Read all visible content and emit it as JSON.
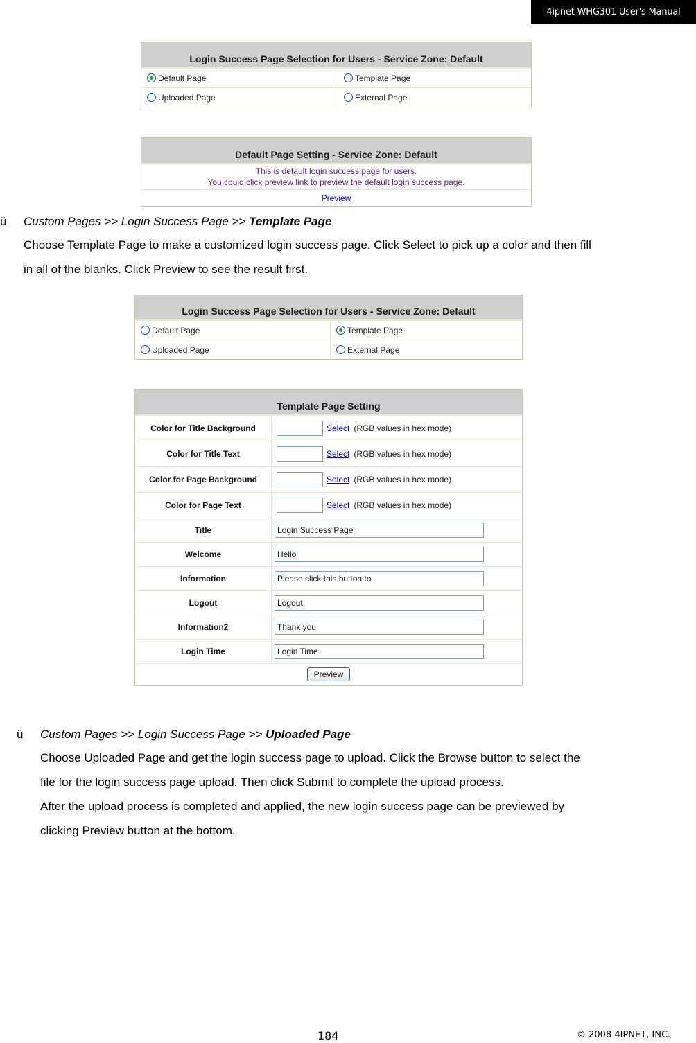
{
  "header": {
    "manual_title": "4ipnet WHG301 User's Manual"
  },
  "selection_panel_1": {
    "title": "Login Success Page Selection for Users - Service Zone: Default",
    "options": [
      {
        "label": "Default Page",
        "checked": true
      },
      {
        "label": "Template Page",
        "checked": false
      },
      {
        "label": "Uploaded Page",
        "checked": false
      },
      {
        "label": "External Page",
        "checked": false
      }
    ]
  },
  "default_setting_panel": {
    "title": "Default Page Setting - Service Zone: Default",
    "line1": "This is default login success page for users.",
    "line2": "You could click preview link to preview the default login success page.",
    "preview_link": "Preview"
  },
  "section_template": {
    "bullet": "ü",
    "crumb_prefix": "Custom Pages >> Login Success Page >> ",
    "crumb_bold": "Template Page",
    "line1": "Choose Template Page to make a customized login success page. Click Select to pick up a color and then fill",
    "line2": "in all of the blanks. Click Preview to see the result first."
  },
  "selection_panel_2": {
    "title": "Login Success Page Selection for Users - Service Zone: Default",
    "options": [
      {
        "label": "Default Page",
        "checked": false
      },
      {
        "label": "Template Page",
        "checked": true
      },
      {
        "label": "Uploaded Page",
        "checked": false
      },
      {
        "label": "External Page",
        "checked": false
      }
    ]
  },
  "template_panel": {
    "title": "Template Page Setting",
    "color_rows": [
      {
        "label": "Color for Title Background",
        "value": "",
        "select": "Select",
        "hint": "(RGB values in hex mode)"
      },
      {
        "label": "Color for Title Text",
        "value": "",
        "select": "Select",
        "hint": "(RGB values in hex mode)"
      },
      {
        "label": "Color for Page Background",
        "value": "",
        "select": "Select",
        "hint": "(RGB values in hex mode)"
      },
      {
        "label": "Color for Page Text",
        "value": "",
        "select": "Select",
        "hint": "(RGB values in hex mode)"
      }
    ],
    "text_rows": [
      {
        "label": "Title",
        "value": "Login Success Page"
      },
      {
        "label": "Welcome",
        "value": "Hello"
      },
      {
        "label": "Information",
        "value": "Please click this button to"
      },
      {
        "label": "Logout",
        "value": "Logout"
      },
      {
        "label": "Information2",
        "value": "Thank you"
      },
      {
        "label": "Login Time",
        "value": "Login Time"
      }
    ],
    "preview_button": "Preview"
  },
  "section_uploaded": {
    "bullet": "ü",
    "crumb_prefix": "Custom Pages >> Login Success Page >> ",
    "crumb_bold": "Uploaded Page",
    "line1": "Choose Uploaded Page and get the login success page to upload. Click the Browse button to select the",
    "line2": "file for the login success page upload. Then click Submit to complete the upload process.",
    "line3": "After the upload process is completed and applied, the new login success page can be previewed by",
    "line4": "clicking Preview button at the bottom."
  },
  "footer": {
    "page_number": "184",
    "copyright": "© 2008 4IPNET, INC."
  }
}
